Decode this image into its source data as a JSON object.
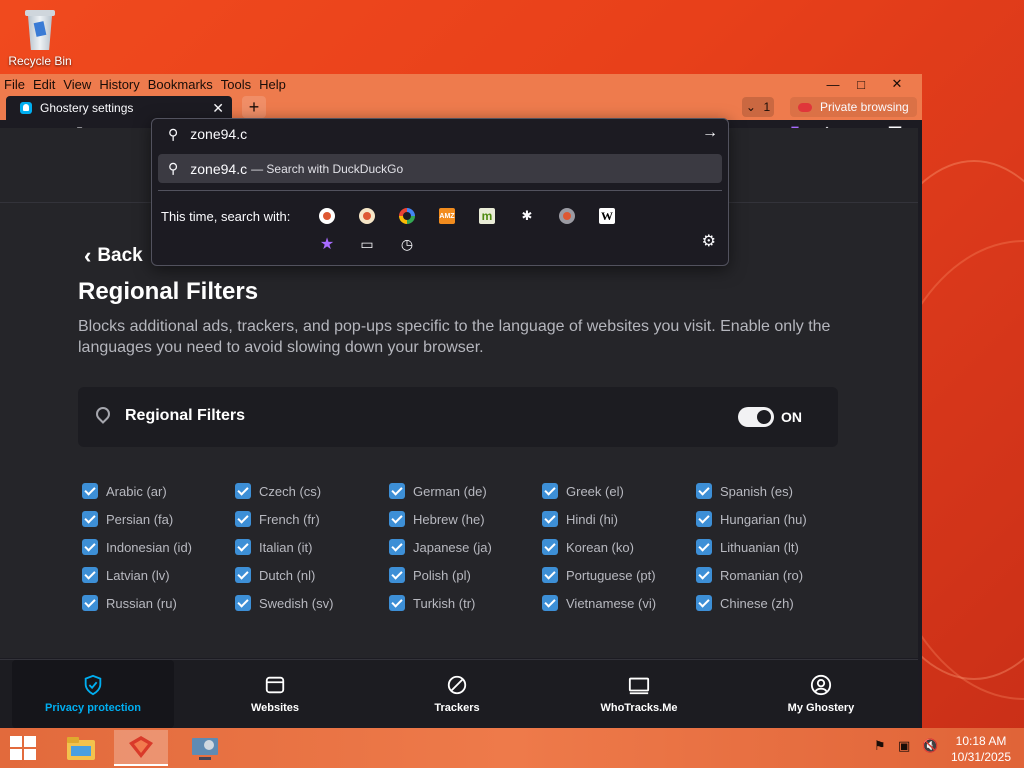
{
  "desktop": {
    "recycle_bin_label": "Recycle Bin"
  },
  "browser": {
    "menu": [
      "File",
      "Edit",
      "View",
      "History",
      "Bookmarks",
      "Tools",
      "Help"
    ],
    "tab": {
      "title": "Ghostery settings"
    },
    "tab_count": "1",
    "private_label": "Private browsing",
    "url": {
      "value": "zone94.c",
      "suggestion_text": "zone94.c",
      "suggestion_sub": "— Search with DuckDuckGo",
      "search_with_label": "This time, search with:"
    }
  },
  "page": {
    "back_label": "Back",
    "title": "Regional Filters",
    "description": "Blocks additional ads, trackers, and pop-ups specific to the language of websites you visit. Enable only the languages you need to avoid slowing down your browser.",
    "card_label": "Regional Filters",
    "toggle_state": "ON",
    "languages": [
      "Arabic (ar)",
      "Czech (cs)",
      "German (de)",
      "Greek (el)",
      "Spanish (es)",
      "Persian (fa)",
      "French (fr)",
      "Hebrew (he)",
      "Hindi (hi)",
      "Hungarian (hu)",
      "Indonesian (id)",
      "Italian (it)",
      "Japanese (ja)",
      "Korean (ko)",
      "Lithuanian (lt)",
      "Latvian (lv)",
      "Dutch (nl)",
      "Polish (pl)",
      "Portuguese (pt)",
      "Romanian (ro)",
      "Russian (ru)",
      "Swedish (sv)",
      "Turkish (tr)",
      "Vietnamese (vi)",
      "Chinese (zh)"
    ]
  },
  "bottom_nav": [
    {
      "label": "Privacy protection",
      "icon": "shield-icon",
      "active": true
    },
    {
      "label": "Websites",
      "icon": "window-icon"
    },
    {
      "label": "Trackers",
      "icon": "block-icon"
    },
    {
      "label": "WhoTracks.Me",
      "icon": "screen-icon"
    },
    {
      "label": "My Ghostery",
      "icon": "user-icon"
    }
  ],
  "taskbar": {
    "time": "10:18 AM",
    "date": "10/31/2025"
  },
  "colors": {
    "accent": "#00aef0",
    "checkbox": "#3d8fd6",
    "menubar": "#ee7b4d"
  }
}
